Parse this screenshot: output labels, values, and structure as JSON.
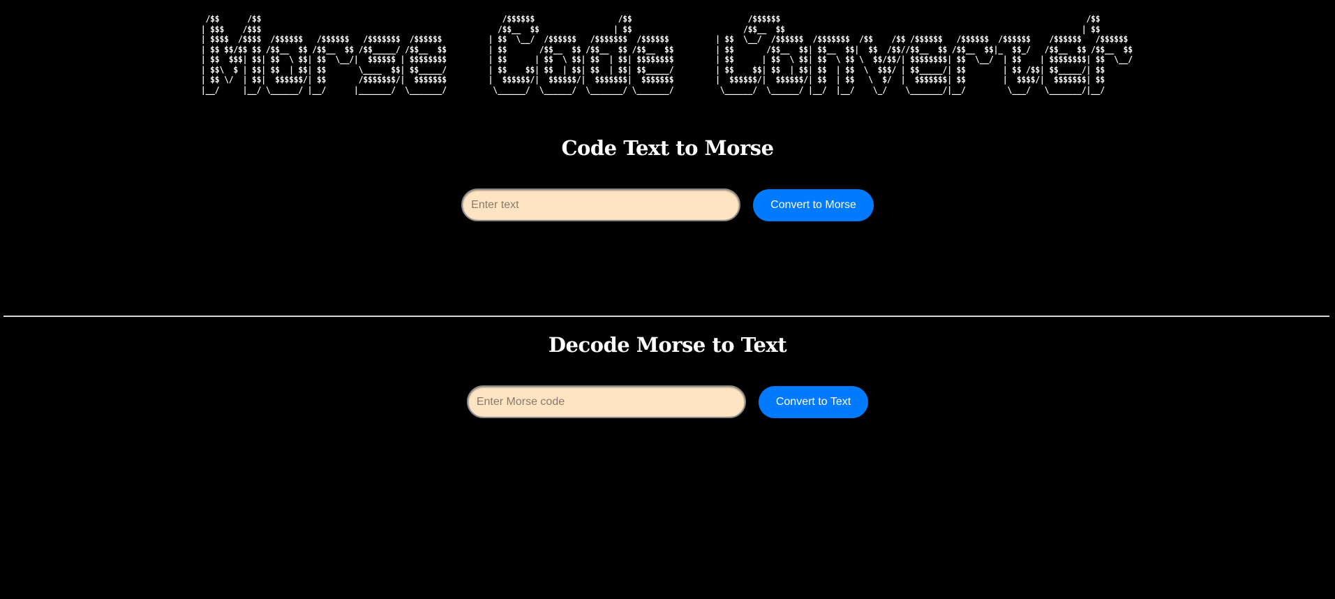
{
  "banner": {
    "ascii_art": " /$$      /$$                                                    /$$$$$$                  /$$                         /$$$$$$                                                                  /$$\n| $$$    /$$$                                                   /$$__  $$                | $$                        /$$__  $$                                                                | $$\n| $$$$  /$$$$  /$$$$$$   /$$$$$$   /$$$$$$$  /$$$$$$          | $$  \\__/  /$$$$$$   /$$$$$$$  /$$$$$$          | $$  \\__/  /$$$$$$  /$$$$$$$  /$$    /$$ /$$$$$$   /$$$$$$  /$$$$$$    /$$$$$$   /$$$$$$\n| $$ $$/$$ $$ /$$__  $$ /$$__  $$ /$$_____/ /$$__  $$         | $$       /$$__  $$ /$$__  $$ /$$__  $$         | $$       /$$__  $$| $$__  $$|  $$  /$$//$$__  $$ /$$__  $$|_  $$_/   /$$__  $$ /$$__  $$\n| $$  $$$| $$| $$  \\ $$| $$  \\__/|  $$$$$$ | $$$$$$$$         | $$      | $$  \\ $$| $$  | $$| $$$$$$$$         | $$      | $$  \\ $$| $$  \\ $$ \\  $$/$$/| $$$$$$$$| $$  \\__/  | $$    | $$$$$$$$| $$  \\__/\n| $$\\  $ | $$| $$  | $$| $$       \\____  $$| $$_____/         | $$    $$| $$  | $$| $$  | $$| $$_____/         | $$    $$| $$  | $$| $$  | $$  \\  $$$/ | $$_____/| $$        | $$ /$$| $$_____/| $$\n| $$ \\/  | $$|  $$$$$$/| $$       /$$$$$$$/|  $$$$$$$         |  $$$$$$/|  $$$$$$/|  $$$$$$$|  $$$$$$$         |  $$$$$$/|  $$$$$$/| $$  | $$   \\  $/  |  $$$$$$$| $$        |  $$$$/|  $$$$$$$| $$\n|__/     |__/ \\______/ |__/      |_______/  \\_______/          \\______/  \\______/  \\_______/ \\_______/          \\______/  \\______/ |__/  |__/    \\_/    \\_______/|__/         \\___/   \\_______/|__/"
  },
  "encode": {
    "title": "Code Text to Morse",
    "placeholder": "Enter text",
    "value": "",
    "button_label": "Convert to Morse",
    "output": ""
  },
  "decode": {
    "title": "Decode Morse to Text",
    "placeholder": "Enter Morse code",
    "value": "",
    "button_label": "Convert to Text",
    "output": ""
  },
  "colors": {
    "background": "#000000",
    "text": "#ffffff",
    "input_background": "#ffe4c4",
    "button_background": "#007bff",
    "divider": "#d9d9d9"
  }
}
